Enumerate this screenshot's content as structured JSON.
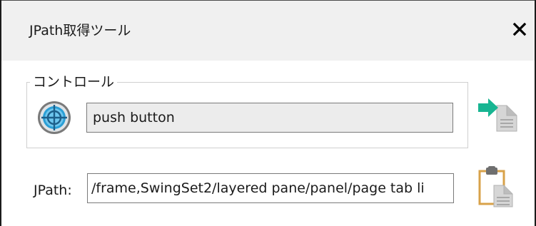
{
  "window": {
    "title": "JPath取得ツール",
    "close_symbol": "✕"
  },
  "control_group": {
    "legend": "コントロール",
    "target_icon": "crosshair-target-icon",
    "control_value": "push button",
    "export_icon": "arrow-to-document-icon"
  },
  "jpath": {
    "label": "JPath:",
    "value": "/frame,SwingSet2/layered pane/panel/page tab li",
    "copy_icon": "clipboard-copy-icon"
  },
  "colors": {
    "title_bg": "#f0f0f0",
    "field_readonly_bg": "#ececec",
    "accent_teal": "#18b592",
    "target_blue": "#2a9fd6"
  }
}
